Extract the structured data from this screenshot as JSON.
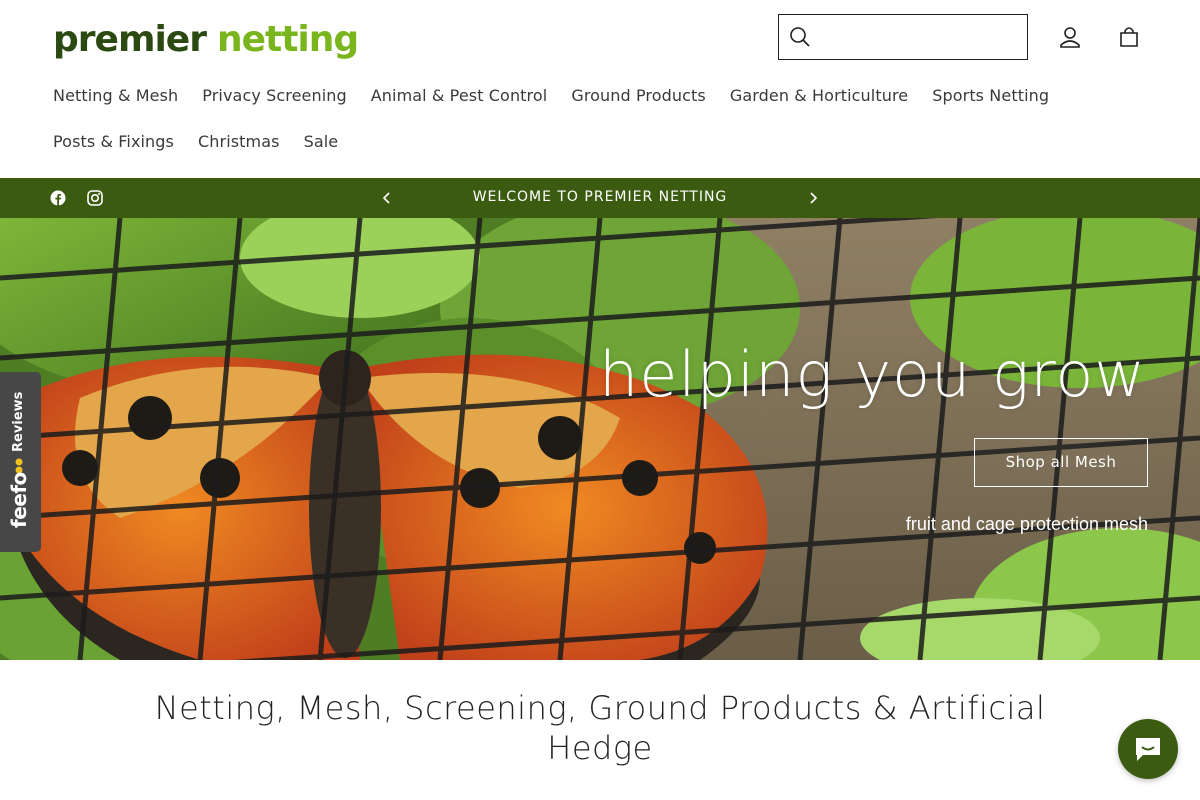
{
  "brand": {
    "name_part1": "premier",
    "name_part2": "netting"
  },
  "search": {
    "placeholder": "",
    "value": ""
  },
  "header_icons": {
    "account": "user-icon",
    "cart": "bag-icon"
  },
  "nav": {
    "items": [
      {
        "label": "Netting & Mesh"
      },
      {
        "label": "Privacy Screening"
      },
      {
        "label": "Animal & Pest Control"
      },
      {
        "label": "Ground Products"
      },
      {
        "label": "Garden & Horticulture"
      },
      {
        "label": "Sports Netting"
      },
      {
        "label": "Posts & Fixings"
      },
      {
        "label": "Christmas"
      },
      {
        "label": "Sale"
      }
    ]
  },
  "announcement": {
    "message": "WELCOME TO PREMIER NETTING",
    "social": [
      "facebook-icon",
      "instagram-icon"
    ]
  },
  "hero": {
    "title": "helping you grow",
    "button_label": "Shop all Mesh",
    "subtitle": "fruit and cage protection mesh"
  },
  "feefo": {
    "reviews_label": "Reviews",
    "brand": "feefo"
  },
  "section": {
    "title": "Netting, Mesh, Screening, Ground Products & Artificial Hedge"
  },
  "colors": {
    "brand_dark": "#2b4a12",
    "brand_light": "#7ab51d",
    "announcement_bg": "#3b5c10",
    "chat_bg": "#3b5c10"
  }
}
